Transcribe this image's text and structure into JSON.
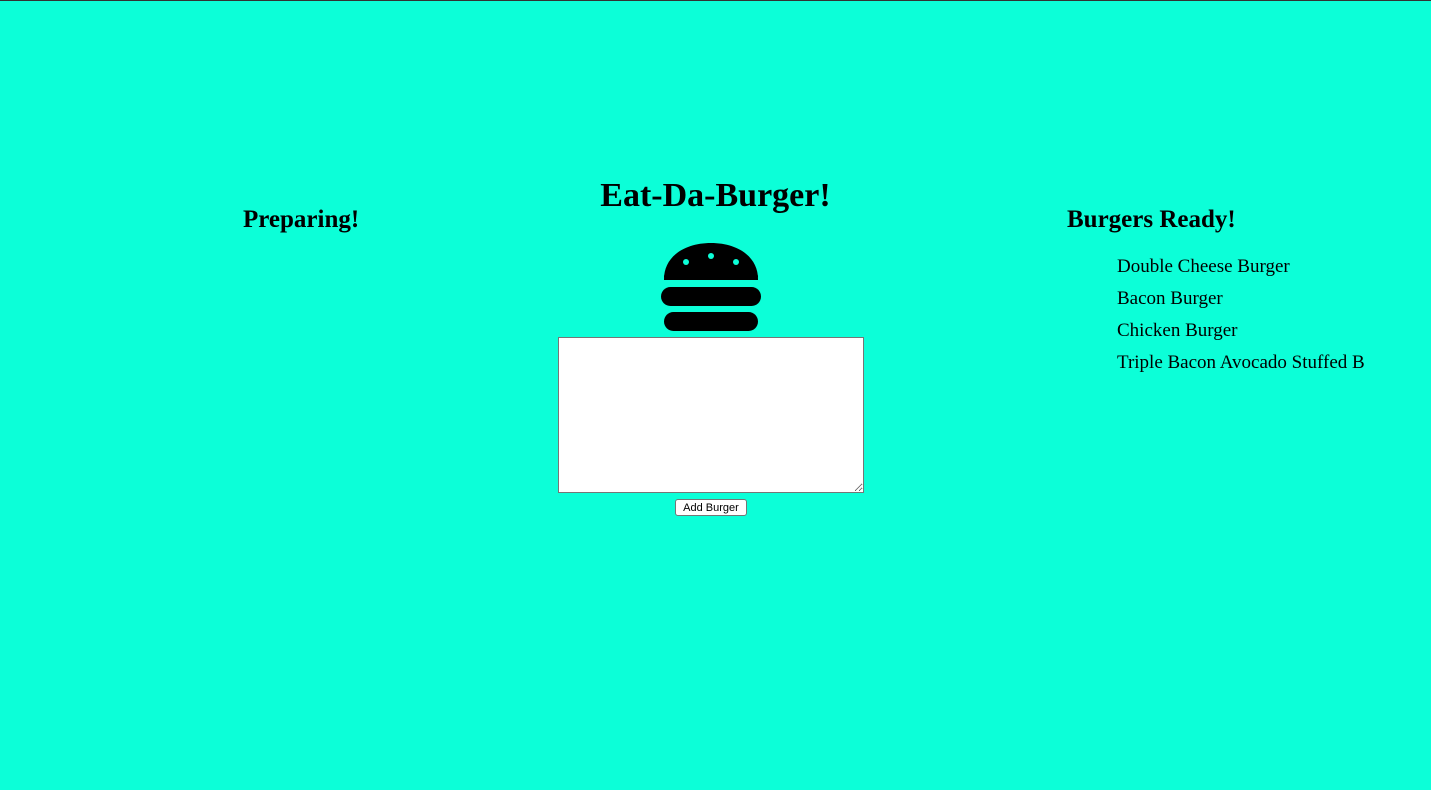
{
  "page": {
    "title": "Eat-Da-Burger!",
    "background_color": "#0cffd8"
  },
  "preparing": {
    "heading": "Preparing!",
    "items": []
  },
  "order_form": {
    "input_value": "",
    "button_label": "Add Burger",
    "icon": "burger-icon"
  },
  "ready": {
    "heading": "Burgers Ready!",
    "items": [
      {
        "name": "Double Cheese Burger"
      },
      {
        "name": "Bacon Burger"
      },
      {
        "name": "Chicken Burger"
      },
      {
        "name": "Triple Bacon Avocado Stuffed B"
      }
    ]
  }
}
